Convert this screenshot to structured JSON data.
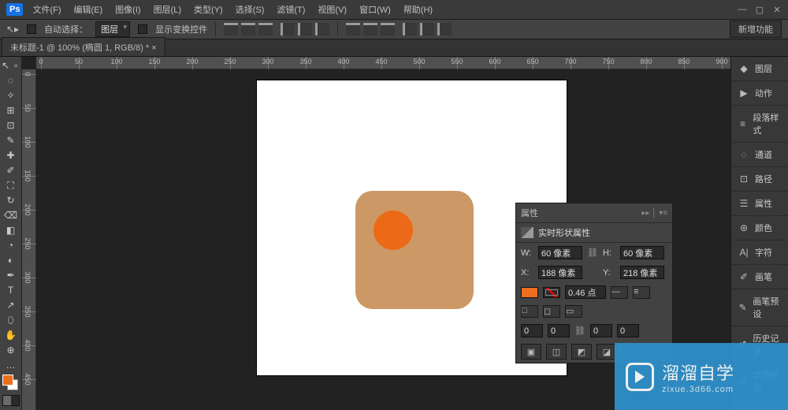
{
  "app": {
    "logo": "Ps"
  },
  "menu": [
    "文件(F)",
    "编辑(E)",
    "图像(I)",
    "图层(L)",
    "类型(Y)",
    "选择(S)",
    "滤镜(T)",
    "视图(V)",
    "窗口(W)",
    "帮助(H)"
  ],
  "winctrl": {
    "min": "—",
    "max": "▢",
    "close": "✕"
  },
  "options": {
    "auto_select_label": "自动选择：",
    "combo_value": "图层",
    "show_transform_label": "显示变换控件",
    "new_feature": "新增功能"
  },
  "doc_tab": "未标题-1 @ 100% (椭圆 1, RGB/8) * ×",
  "ruler_h": [
    0,
    50,
    100,
    150,
    200,
    250,
    300,
    350,
    400,
    450,
    500,
    550,
    600,
    650,
    700,
    750,
    800,
    850,
    900
  ],
  "ruler_v": [
    0,
    50,
    100,
    150,
    200,
    250,
    300,
    350,
    400,
    450
  ],
  "tools": [
    "↖",
    "◌",
    "⊞",
    "✎",
    "⊡",
    "✂",
    "✐",
    "◍",
    "▱",
    "⌫",
    "◔",
    "⌁",
    "T",
    "⬯",
    "✋",
    "⊕",
    "…"
  ],
  "properties": {
    "tab": "属性",
    "subtitle": "实时形状属性",
    "w_label": "W:",
    "w_value": "60 像素",
    "h_label": "H:",
    "h_value": "60 像素",
    "x_label": "X:",
    "x_value": "188 像素",
    "y_label": "Y:",
    "y_value": "218 像素",
    "stroke_weight": "0.46 点",
    "seg_values": [
      "0",
      "0",
      "0",
      "0"
    ],
    "link": "⛓",
    "more": "▸▸ │ ▾≡"
  },
  "dock": [
    {
      "icon": "◆",
      "label": "图层"
    },
    {
      "icon": "▶",
      "label": "动作"
    },
    {
      "icon": "≡",
      "label": "段落样式"
    },
    {
      "icon": "◌",
      "label": "通道"
    },
    {
      "icon": "⊡",
      "label": "路径"
    },
    {
      "icon": "☰",
      "label": "属性"
    },
    {
      "icon": "⊛",
      "label": "颜色"
    },
    {
      "icon": "A|",
      "label": "字符"
    },
    {
      "icon": "✐",
      "label": "画笔"
    },
    {
      "icon": "✎",
      "label": "画笔预设"
    },
    {
      "icon": "↺",
      "label": "历史记录"
    },
    {
      "icon": "A",
      "label": "字符样式"
    }
  ],
  "watermark": {
    "title": "溜溜自学",
    "url": "zixue.3d66.com"
  }
}
